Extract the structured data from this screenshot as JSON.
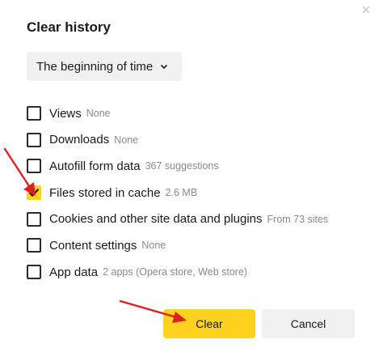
{
  "dialog": {
    "title": "Clear history",
    "close_icon": "close-icon",
    "range_select": {
      "value": "The beginning of time",
      "icon": "chevron-down-icon"
    },
    "items": [
      {
        "label": "Views",
        "meta": "None",
        "checked": false
      },
      {
        "label": "Downloads",
        "meta": "None",
        "checked": false
      },
      {
        "label": "Autofill form data",
        "meta": "367 suggestions",
        "checked": false
      },
      {
        "label": "Files stored in cache",
        "meta": "2.6 MB",
        "checked": true
      },
      {
        "label": "Cookies and other site data and plugins",
        "meta": "From 73 sites",
        "checked": false
      },
      {
        "label": "Content settings",
        "meta": "None",
        "checked": false
      },
      {
        "label": "App data",
        "meta": "2 apps (Opera store, Web store)",
        "checked": false
      }
    ],
    "buttons": {
      "clear_label": "Clear",
      "cancel_label": "Cancel"
    }
  },
  "colors": {
    "accent": "#ffd21f",
    "annotation_arrow": "#e02020",
    "button_secondary": "#f1f1f1"
  }
}
